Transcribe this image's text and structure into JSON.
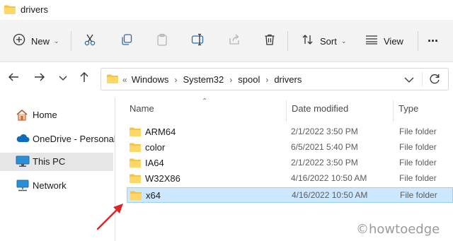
{
  "window": {
    "title": "drivers"
  },
  "toolbar": {
    "new_label": "New",
    "sort_label": "Sort",
    "view_label": "View",
    "more_label": "···",
    "icons": [
      "cut-icon",
      "copy-icon",
      "paste-icon",
      "rename-icon",
      "share-icon",
      "delete-icon"
    ]
  },
  "addressbar": {
    "lead": "«",
    "crumbs": [
      "Windows",
      "System32",
      "spool",
      "drivers"
    ]
  },
  "nav": {
    "items": [
      {
        "label": "Home",
        "icon": "home-icon"
      },
      {
        "label": "OneDrive - Personal",
        "icon": "onedrive-icon"
      },
      {
        "label": "This PC",
        "icon": "this-pc-icon",
        "selected": true
      },
      {
        "label": "Network",
        "icon": "network-icon"
      }
    ]
  },
  "columns": {
    "name": "Name",
    "date": "Date modified",
    "type": "Type"
  },
  "files": [
    {
      "name": "ARM64",
      "date": "2/1/2022 3:50 PM",
      "type": "File folder"
    },
    {
      "name": "color",
      "date": "6/5/2021 5:40 PM",
      "type": "File folder"
    },
    {
      "name": "IA64",
      "date": "2/1/2022 3:50 PM",
      "type": "File folder"
    },
    {
      "name": "W32X86",
      "date": "4/16/2022 10:50 AM",
      "type": "File folder"
    },
    {
      "name": "x64",
      "date": "4/16/2022 10:50 AM",
      "type": "File folder",
      "selected": true
    }
  ],
  "watermark": "©howtoedge",
  "colors": {
    "folder": "#f4c542",
    "selection": "#cce8ff",
    "annotation_arrow": "#d92626"
  }
}
